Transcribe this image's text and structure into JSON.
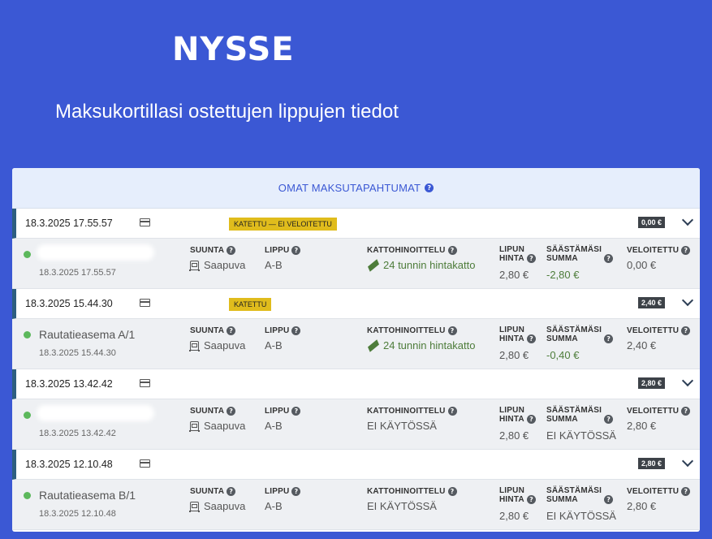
{
  "header": {
    "logo": "NYSSE",
    "title": "Maksukortillasi ostettujen lippujen tiedot"
  },
  "panel": {
    "title": "OMAT MAKSUTAPAHTUMAT",
    "help_icon": "question-circle-icon"
  },
  "labels": {
    "direction": "SUUNTA",
    "ticket": "LIPPU",
    "price_cap": "KATTOHINOITTELU",
    "ticket_price_l1": "LIPUN",
    "ticket_price_l2": "HINTA",
    "savings_l1": "SÄÄSTÄMÄSI",
    "savings_l2": "SUMMA",
    "charged": "VELOITETTU"
  },
  "transactions": [
    {
      "datetime": "18.3.2025 17.55.57",
      "status": "KATETTU — EI VELOITETTU",
      "amount": "0,00 €",
      "stop": "",
      "stop_hidden": true,
      "sub_datetime": "18.3.2025 17.55.57",
      "direction": "Saapuva",
      "ticket": "A-B",
      "price_cap": "24 tunnin hintakatto",
      "price_cap_active": true,
      "ticket_price": "2,80 €",
      "savings": "-2,80 €",
      "charged": "0,00 €"
    },
    {
      "datetime": "18.3.2025 15.44.30",
      "status": "KATETTU",
      "amount": "2,40 €",
      "stop": "Rautatieasema A/1",
      "stop_hidden": false,
      "sub_datetime": "18.3.2025 15.44.30",
      "direction": "Saapuva",
      "ticket": "A-B",
      "price_cap": "24 tunnin hintakatto",
      "price_cap_active": true,
      "ticket_price": "2,80 €",
      "savings": "-0,40 €",
      "charged": "2,40 €"
    },
    {
      "datetime": "18.3.2025 13.42.42",
      "status": "",
      "amount": "2,80 €",
      "stop": "",
      "stop_hidden": true,
      "sub_datetime": "18.3.2025 13.42.42",
      "direction": "Saapuva",
      "ticket": "A-B",
      "price_cap": "EI KÄYTÖSSÄ",
      "price_cap_active": false,
      "ticket_price": "2,80 €",
      "savings": "EI KÄYTÖSSÄ",
      "charged": "2,80 €"
    },
    {
      "datetime": "18.3.2025 12.10.48",
      "status": "",
      "amount": "2,80 €",
      "stop": "Rautatieasema B/1",
      "stop_hidden": false,
      "sub_datetime": "18.3.2025 12.10.48",
      "direction": "Saapuva",
      "ticket": "A-B",
      "price_cap": "EI KÄYTÖSSÄ",
      "price_cap_active": false,
      "ticket_price": "2,80 €",
      "savings": "EI KÄYTÖSSÄ",
      "charged": "2,80 €"
    }
  ],
  "colors": {
    "background": "#3b58d4",
    "badge_yellow": "#e0bc1c",
    "amount_badge": "#3d4248",
    "green_dot": "#5cb85c",
    "cap_green": "#4d7c3a"
  }
}
